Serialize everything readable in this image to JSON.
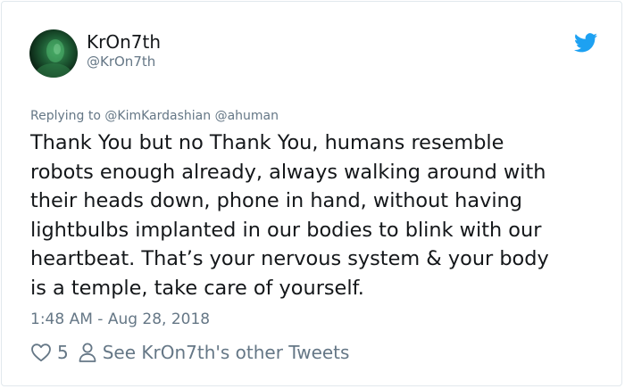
{
  "tweet": {
    "author": {
      "display_name": "KrOn7th",
      "handle": "@KrOn7th",
      "avatar_icon": "avatar-photo"
    },
    "platform_icon": "twitter-bird-icon",
    "replying": {
      "prefix": "Replying to",
      "mentions": [
        "@KimKardashian",
        "@ahuman"
      ]
    },
    "text_lines": [
      "Thank You but no Thank You, humans resemble",
      "robots enough already, always walking around with",
      "their heads down, phone in hand, without having",
      "lightbulbs implanted in our bodies to blink with our",
      "heartbeat. That’s your nervous system & your body",
      "is a temple, take care of yourself."
    ],
    "timestamp": "1:48 AM - Aug 28, 2018",
    "like_count": "5",
    "other_tweets_label": "See KrOn7th's other Tweets",
    "colors": {
      "text": "#14171a",
      "secondary": "#657786",
      "brand": "#1da1f2",
      "border": "#e1e8ed"
    }
  }
}
